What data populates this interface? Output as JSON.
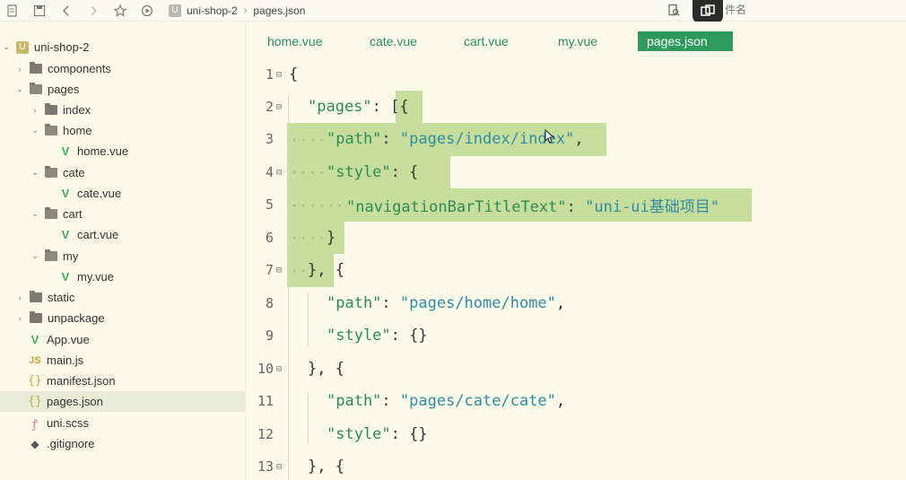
{
  "toolbar": {
    "crumb_project": "uni-shop-2",
    "crumb_file": "pages.json",
    "search_placeholder": "件名"
  },
  "sidebar": {
    "root": "uni-shop-2",
    "items": [
      {
        "label": "components",
        "type": "folder"
      },
      {
        "label": "pages",
        "type": "folder-open"
      },
      {
        "label": "index",
        "type": "folder"
      },
      {
        "label": "home",
        "type": "folder-open"
      },
      {
        "label": "home.vue",
        "type": "vue"
      },
      {
        "label": "cate",
        "type": "folder-open"
      },
      {
        "label": "cate.vue",
        "type": "vue"
      },
      {
        "label": "cart",
        "type": "folder-open"
      },
      {
        "label": "cart.vue",
        "type": "vue"
      },
      {
        "label": "my",
        "type": "folder-open"
      },
      {
        "label": "my.vue",
        "type": "vue"
      },
      {
        "label": "static",
        "type": "folder"
      },
      {
        "label": "unpackage",
        "type": "folder"
      },
      {
        "label": "App.vue",
        "type": "vue"
      },
      {
        "label": "main.js",
        "type": "js"
      },
      {
        "label": "manifest.json",
        "type": "json"
      },
      {
        "label": "pages.json",
        "type": "json"
      },
      {
        "label": "uni.scss",
        "type": "scss"
      },
      {
        "label": ".gitignore",
        "type": "git"
      }
    ]
  },
  "tabs": [
    "home.vue",
    "cate.vue",
    "cart.vue",
    "my.vue",
    "pages.json"
  ],
  "editor": {
    "line_numbers": [
      "1",
      "2",
      "3",
      "4",
      "5",
      "6",
      "7",
      "8",
      "9",
      "10",
      "11",
      "12",
      "13"
    ],
    "tokens": {
      "l1": "{",
      "l2_key": "\"pages\"",
      "l2_rest": ": [{",
      "l3_key": "\"path\"",
      "l3_colon": ": ",
      "l3_val": "\"pages/index/index\"",
      "l3_comma": ",",
      "l4_key": "\"style\"",
      "l4_rest": ": {",
      "l5_key": "\"navigationBarTitleText\"",
      "l5_colon": ": ",
      "l5_val": "\"uni-ui基础项目\"",
      "l6": "}",
      "l7": "}, {",
      "l8_key": "\"path\"",
      "l8_colon": ": ",
      "l8_val": "\"pages/home/home\"",
      "l8_comma": ",",
      "l9_key": "\"style\"",
      "l9_rest": ": {}",
      "l10": "}, {",
      "l11_key": "\"path\"",
      "l11_colon": ": ",
      "l11_val": "\"pages/cate/cate\"",
      "l11_comma": ",",
      "l12_key": "\"style\"",
      "l12_rest": ": {}",
      "l13": "}, {"
    }
  }
}
